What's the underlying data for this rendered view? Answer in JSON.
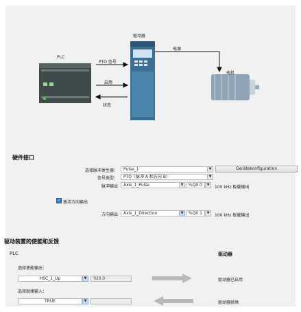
{
  "diagram": {
    "plc_label": "PLC",
    "drive_label": "驱动器",
    "motor_label": "电机",
    "power_label": "电源",
    "pto_signal": "PTO 信号",
    "enable_signal": "启用",
    "ready_signal": "状态"
  },
  "hardware": {
    "title": "硬件接口",
    "pulse_gen_label": "选择脉冲发生器：",
    "pulse_gen_value": "Pulse_1",
    "device_config_button": "Gerätekonfiguration",
    "signal_type_label": "信号类型：",
    "signal_type_value": "PTO（脉冲 A 和方向 B）",
    "pulse_output_label": "脉冲输出",
    "pulse_output_tag": "Axis_1_Pulse",
    "pulse_output_addr": "%Q0.0",
    "pulse_output_freq": "100 kHz 板载输出",
    "dir_checkbox_label": "激活方向输出",
    "dir_output_label": "方向输出",
    "dir_output_tag": "Axis_1_Direction",
    "dir_output_addr": "%Q0.1",
    "dir_output_freq": "100 kHz 板载输出"
  },
  "drive": {
    "title": "驱动装置的使能和反馈",
    "plc_col": "PLC",
    "drive_col": "驱动器",
    "enable_out_label": "选择使能输出：",
    "enable_out_tag": "HSC_1_Up",
    "enable_out_addr": "%I0.0",
    "enable_out_desc": "驱动器已启用",
    "ready_in_label": "选择就绪输入：",
    "ready_in_value": "TRUE",
    "ready_in_desc": "驱动器就绪"
  },
  "colors": {
    "plc_body": "#3f4a4a",
    "drive_body": "#3b6f93",
    "motor_body": "#8fa3b5",
    "arrow_gray": "#b9b9b9",
    "checkbox_blue": "#3a78c8"
  }
}
